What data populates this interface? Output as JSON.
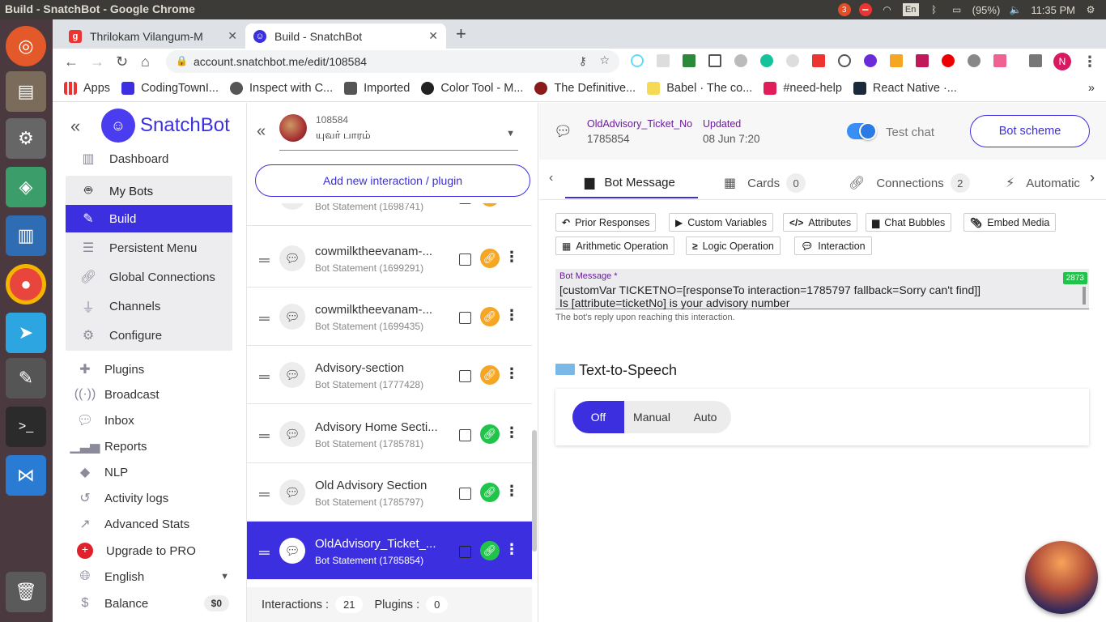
{
  "window_title": "Build - SnatchBot - Google Chrome",
  "tray": {
    "badge": "3",
    "battery": "(95%)",
    "time": "11:35 PM",
    "keyboard": "En"
  },
  "tabs": [
    {
      "label": "Thrilokam Vilangum-M",
      "fav": "g"
    },
    {
      "label": "Build - SnatchBot",
      "fav": "bot"
    }
  ],
  "url": "account.snatchbot.me/edit/108584",
  "profile_initial": "N",
  "bookmarks": [
    "Apps",
    "CodingTownI...",
    "Inspect with C...",
    "Imported",
    "Color Tool - M...",
    "The Definitive...",
    "Babel · The co...",
    "#need-help",
    "React Native ·..."
  ],
  "nav": {
    "brand": "SnatchBot",
    "dashboard": "Dashboard",
    "box": [
      "My Bots",
      "Build",
      "Persistent Menu",
      "Global Connections",
      "Channels",
      "Configure"
    ],
    "items": [
      "Plugins",
      "Broadcast",
      "Inbox",
      "Reports",
      "NLP",
      "Activity logs",
      "Advanced Stats",
      "Upgrade to PRO",
      "English",
      "Balance"
    ],
    "balance": "$0"
  },
  "bot": {
    "id": "108584",
    "name": "யுவர் பாரம்"
  },
  "add_button": "Add new interaction / plugin",
  "interactions": [
    {
      "title": "",
      "sub": "Bot Statement (1698741)",
      "link": "orange"
    },
    {
      "title": "cowmilktheevanam-...",
      "sub": "Bot Statement (1699291)",
      "link": "orange"
    },
    {
      "title": "cowmilktheevanam-...",
      "sub": "Bot Statement (1699435)",
      "link": "orange"
    },
    {
      "title": "Advisory-section",
      "sub": "Bot Statement (1777428)",
      "link": "orange"
    },
    {
      "title": "Advisory Home Secti...",
      "sub": "Bot Statement (1785781)",
      "link": "green"
    },
    {
      "title": "Old Advisory Section",
      "sub": "Bot Statement (1785797)",
      "link": "green"
    },
    {
      "title": "OldAdvisory_Ticket_...",
      "sub": "Bot Statement (1785854)",
      "link": "green"
    }
  ],
  "footer": {
    "interactions_label": "Interactions :",
    "interactions": "21",
    "plugins_label": "Plugins :",
    "plugins": "0"
  },
  "detail": {
    "name": "OldAdvisory_Ticket_No",
    "id": "1785854",
    "updated_label": "Updated",
    "updated": "08 Jun 7:20",
    "test_chat": "Test chat",
    "scheme": "Bot scheme",
    "tabs": [
      {
        "label": "Bot Message"
      },
      {
        "label": "Cards",
        "count": "0"
      },
      {
        "label": "Connections",
        "count": "2"
      },
      {
        "label": "Automatic"
      }
    ],
    "chips": [
      "Prior Responses",
      "Custom Variables",
      "Attributes",
      "Chat Bubbles",
      "Embed Media",
      "Arithmetic Operation",
      "Logic Operation",
      "Interaction"
    ],
    "msg_label": "Bot Message *",
    "msg_count": "2873",
    "msg_line1": "[customVar TICKETNO=[responseTo interaction=1785797 fallback=Sorry can't find]]",
    "msg_line2": "Is [attribute=ticketNo] is your advisory number",
    "msg_hint": "The bot's reply upon reaching this interaction.",
    "tts_title": "Text-to-Speech",
    "tts": [
      "Off",
      "Manual",
      "Auto"
    ]
  },
  "colors": {
    "brand": "#3c2fe0",
    "green": "#21c44a",
    "orange": "#f5a623",
    "toggle": "#3a8ff5"
  }
}
